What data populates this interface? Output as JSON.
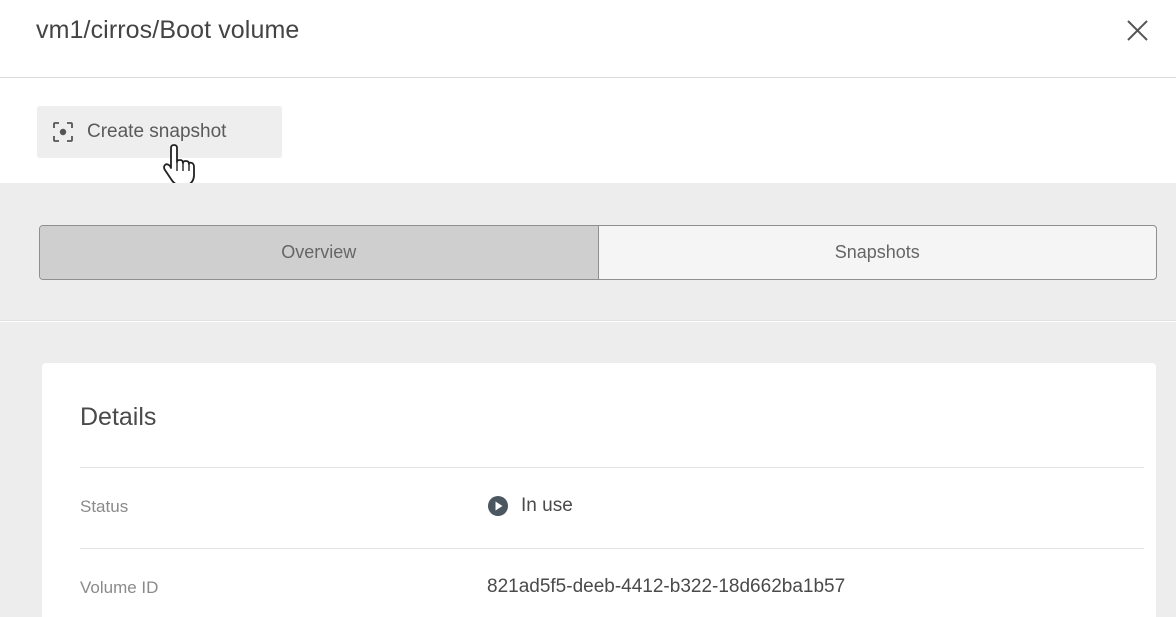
{
  "header": {
    "title": "vm1/cirros/Boot volume",
    "close_icon": "close-icon"
  },
  "toolbar": {
    "create_snapshot_label": "Create snapshot",
    "create_snapshot_icon": "snapshot-focus-icon"
  },
  "tabs": [
    {
      "label": "Overview",
      "active": true
    },
    {
      "label": "Snapshots",
      "active": false
    }
  ],
  "details": {
    "title": "Details",
    "rows": [
      {
        "label": "Status",
        "value": "In use",
        "icon": "play-circle-icon"
      },
      {
        "label": "Volume ID",
        "value": "821ad5f5-deeb-4412-b322-18d662ba1b57"
      }
    ]
  },
  "colors": {
    "active_tab": "#cfcfcf",
    "panel_bg": "#ededed",
    "status_icon": "#4a5660"
  }
}
